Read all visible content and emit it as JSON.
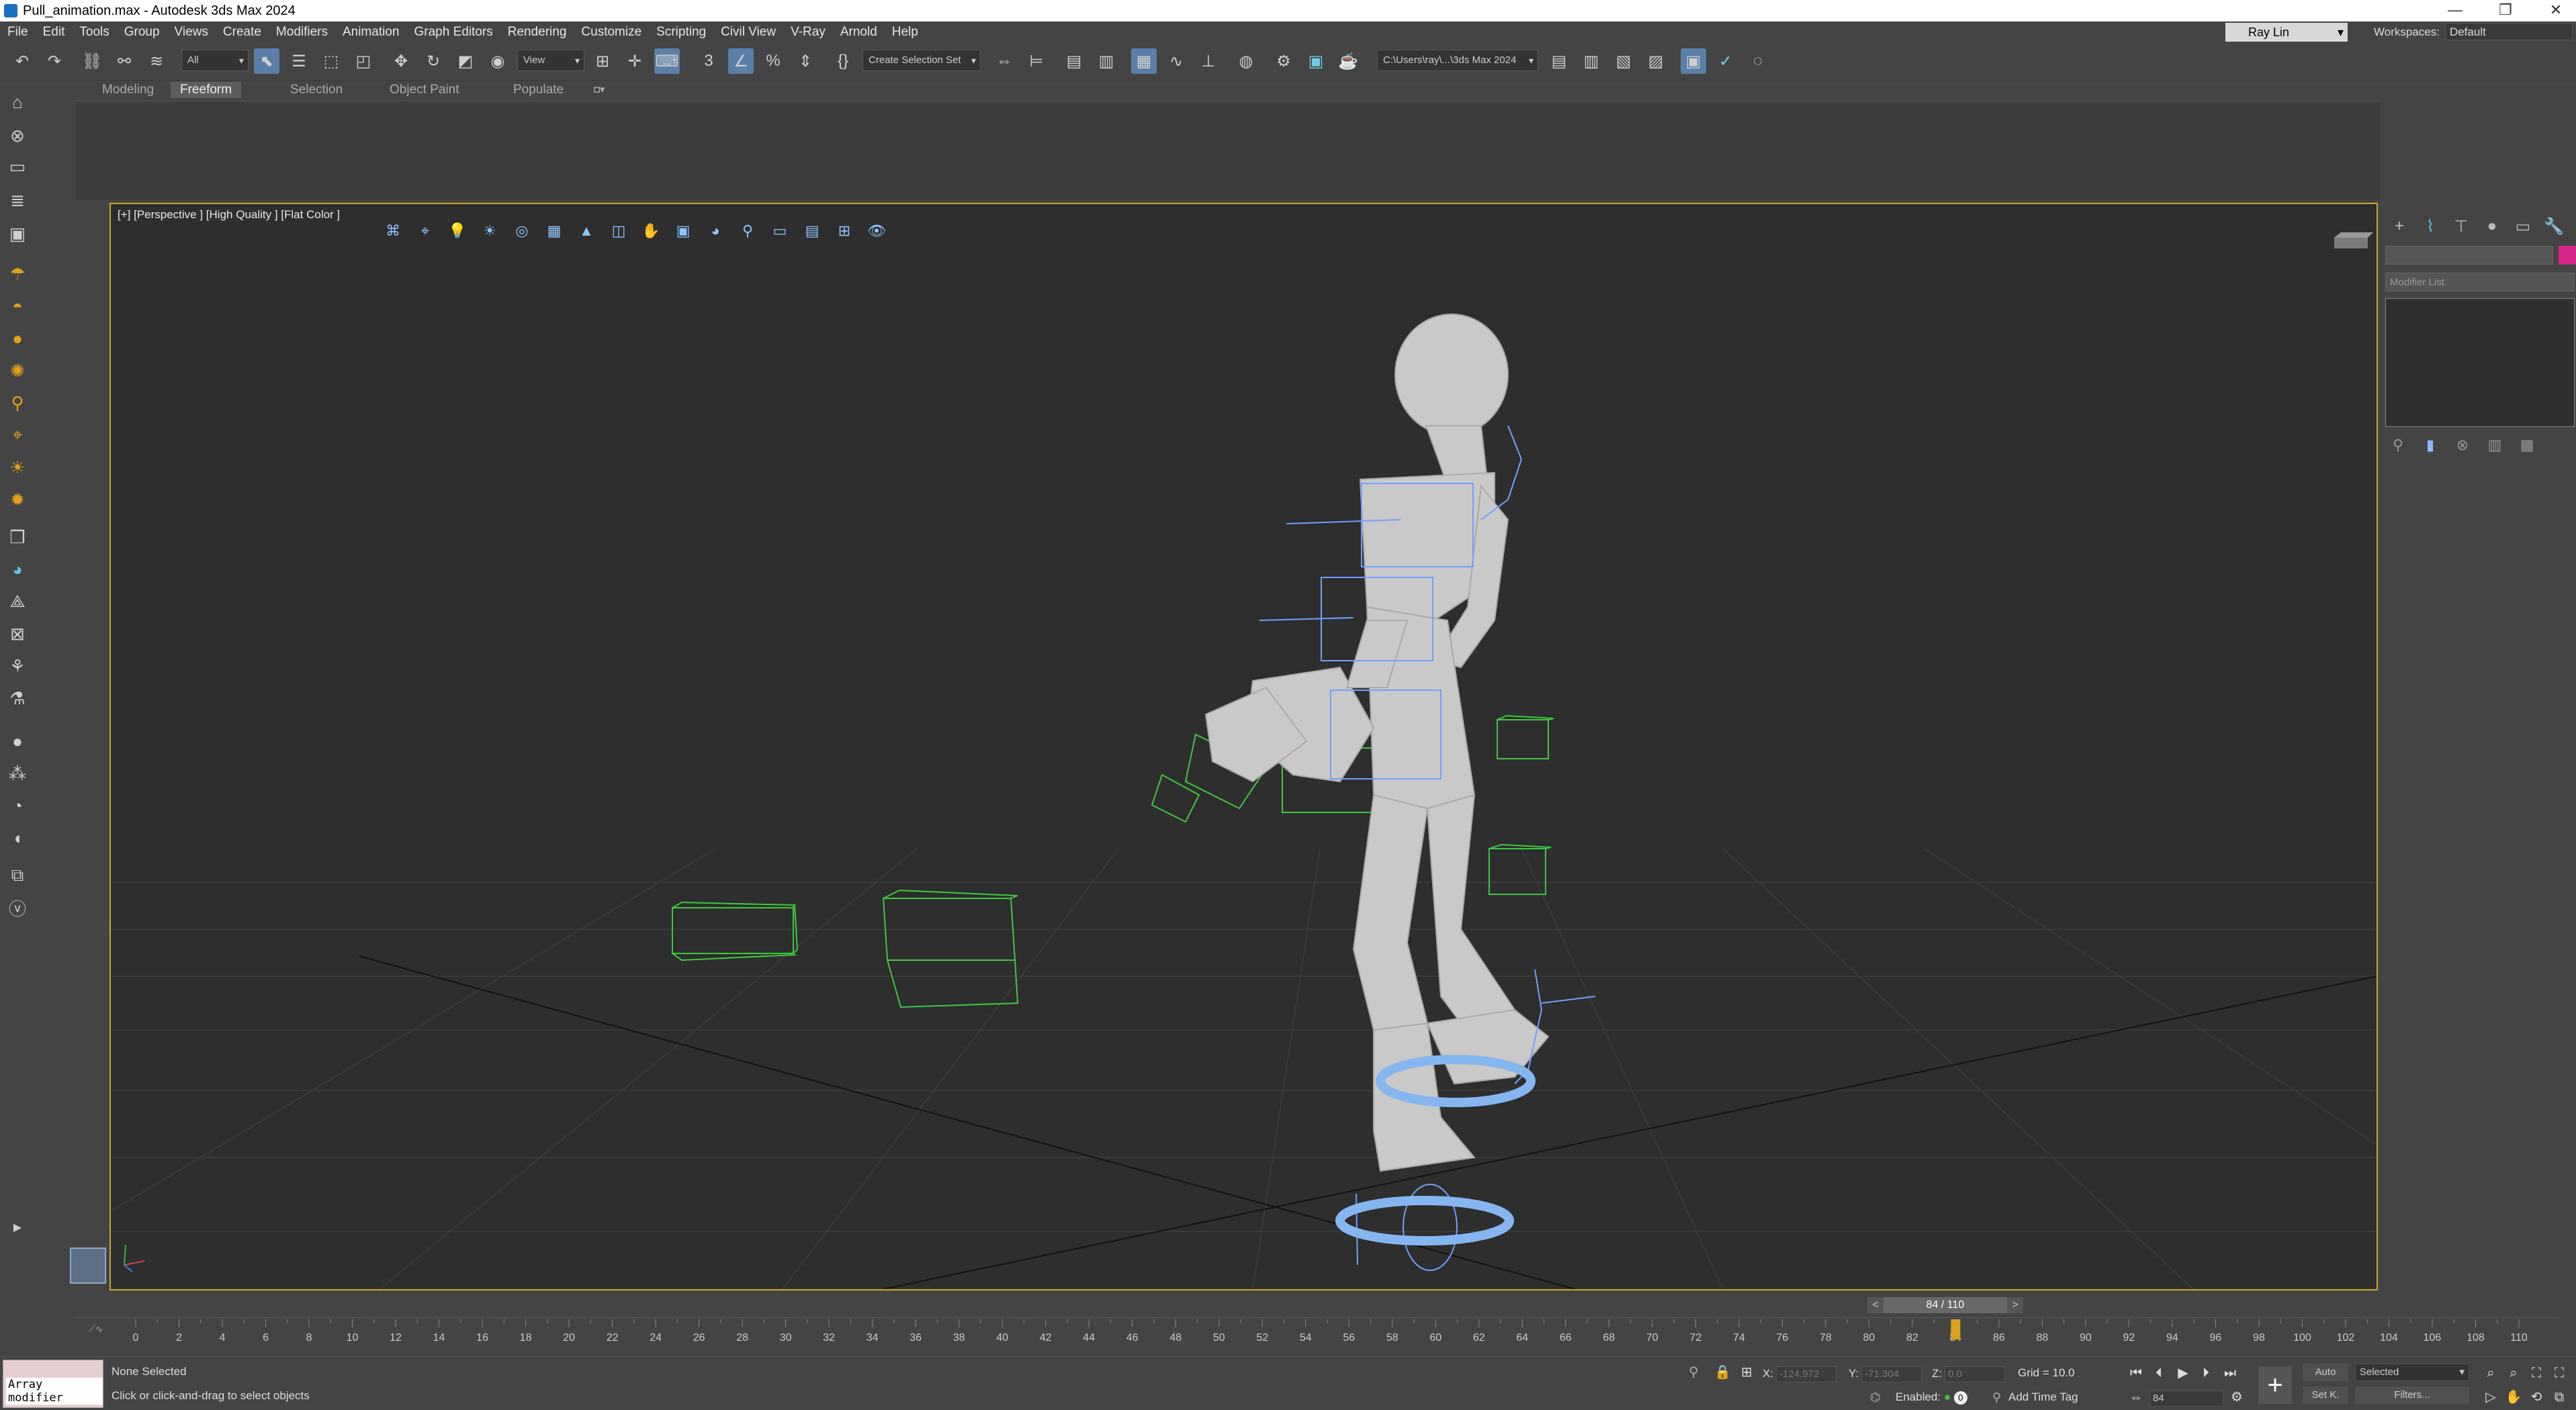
{
  "window": {
    "title": "Pull_animation.max - Autodesk 3ds Max 2024"
  },
  "menus": [
    "File",
    "Edit",
    "Tools",
    "Group",
    "Views",
    "Create",
    "Modifiers",
    "Animation",
    "Graph Editors",
    "Rendering",
    "Customize",
    "Scripting",
    "Civil View",
    "V-Ray",
    "Arnold",
    "Help"
  ],
  "user": {
    "name": "Ray Lin"
  },
  "workspace": {
    "label": "Workspaces:",
    "value": "Default"
  },
  "toolbar": {
    "selection_filter": "All",
    "ref_coord": "View",
    "selection_set": "Create Selection Set",
    "project_path": "C:\\Users\\ray\\...\\3ds Max 2024"
  },
  "ribbon": {
    "tabs": [
      "Modeling",
      "Freeform",
      "Selection",
      "Object Paint",
      "Populate"
    ],
    "active": "Freeform"
  },
  "viewport": {
    "label": "[+] [Perspective ] [High Quality ] [Flat Color ]"
  },
  "command_panel": {
    "modifier_list": "Modifier List",
    "color": "#d6268c"
  },
  "timeline": {
    "current": 84,
    "total": 110,
    "display": "84 / 110",
    "prev": "<",
    "next": ">",
    "ticks": [
      "0",
      "2",
      "4",
      "6",
      "8",
      "10",
      "12",
      "14",
      "16",
      "18",
      "20",
      "22",
      "24",
      "26",
      "28",
      "30",
      "32",
      "34",
      "36",
      "38",
      "40",
      "42",
      "44",
      "46",
      "48",
      "50",
      "52",
      "54",
      "56",
      "58",
      "60",
      "62",
      "64",
      "66",
      "68",
      "70",
      "72",
      "74",
      "76",
      "78",
      "80",
      "82",
      "84",
      "86",
      "88",
      "90",
      "92",
      "94",
      "96",
      "98",
      "100",
      "102",
      "104",
      "106",
      "108",
      "110"
    ]
  },
  "status": {
    "maxscript": "Array modifier",
    "selection": "None Selected",
    "prompt": "Click or click-and-drag to select objects",
    "x_label": "X:",
    "x_value": "-124.972",
    "y_label": "Y:",
    "y_value": "-71.304",
    "z_label": "Z:",
    "z_value": "0.0",
    "grid": "Grid = 10.0",
    "enabled": "Enabled:",
    "add_time_tag": "Add Time Tag",
    "frame": "84",
    "auto": "Auto",
    "setk": "Set K.",
    "selected": "Selected",
    "filters": "Filters..."
  },
  "colors": {
    "viewport_border": "#c8a82c",
    "bone_blue": "#6fa0ff",
    "helper_green": "#3fc83f",
    "mesh": "#c9c9c9",
    "foot_ring": "#86b6f0"
  }
}
